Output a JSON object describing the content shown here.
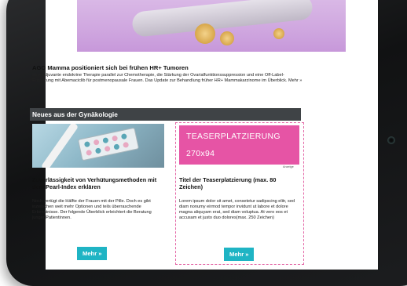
{
  "hero": {
    "alt": ""
  },
  "article_main": {
    "headline": "AGO Mamma positioniert sich bei frühen HR+ Tumoren",
    "body": "Eine adjuvante endokrine Therapie parallel zur Chemotherapie, die Stärkung der Ovarialfunktionssuppression und eine Off-Label-Ergänzung mit Abemaciclib für postmenopausale Frauen. Das Update zur Behandlung früher HR+ Mammakarzinome im Überblick. Mehr »"
  },
  "section": {
    "title": "Neues aus der Gynäkologie"
  },
  "article_left": {
    "title": "Zuverlässigkeit von Verhütungsmethoden mit dem Pearl-Index erklären",
    "body": "Noch vertügt die Hälfte der Frauen mit der Pille. Doch es gibt inzwischen weit mehr Optionen und teils überraschende Erkenntnisse. Der folgende Überblick erleichtert die Beratung junger Patientinnen.",
    "button": "Mehr »"
  },
  "teaser": {
    "line1": "TEASERPLATZIERUNG",
    "line2": "270x94",
    "ad_label": "Anzeige",
    "title": "Titel der Teaserplatzierung (max. 80 Zeichen)",
    "body": "Lorem ipsum dolor sit amet, consetetur sadipscing elitr, sed diam nonumy eirmod tempor invidunt ut labore et dolore magna aliquyam erat, sed diam voluptua. At vero eos et accusam et justo duo dolores(max. 250 Zeichen)",
    "button": "Mehr »"
  },
  "colors": {
    "accent_button": "#1fb4c4",
    "teaser_pink": "#e654a5",
    "section_bar": "#3f4346"
  }
}
